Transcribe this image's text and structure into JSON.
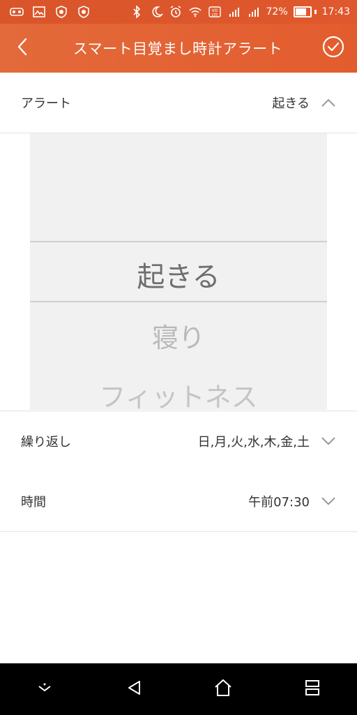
{
  "statusbar": {
    "battery_percent": "72%",
    "time": "17:43"
  },
  "header": {
    "title": "スマート目覚まし時計アラート"
  },
  "rows": {
    "alert": {
      "label": "アラート",
      "value": "起きる"
    },
    "repeat": {
      "label": "繰り返し",
      "value": "日,月,火,水,木,金,土"
    },
    "time": {
      "label": "時間",
      "value": "午前07:30"
    }
  },
  "picker": {
    "options": [
      "起きる",
      "寝り",
      "フィットネス"
    ]
  },
  "icons": {
    "back": "chevron-left-icon",
    "confirm": "check-circle-icon",
    "alert_toggle": "chevron-up-icon",
    "repeat_toggle": "chevron-down-icon",
    "time_toggle": "chevron-down-icon"
  },
  "colors": {
    "header_accent": "#e35c2e",
    "picker_bg": "#f1f1f1"
  }
}
